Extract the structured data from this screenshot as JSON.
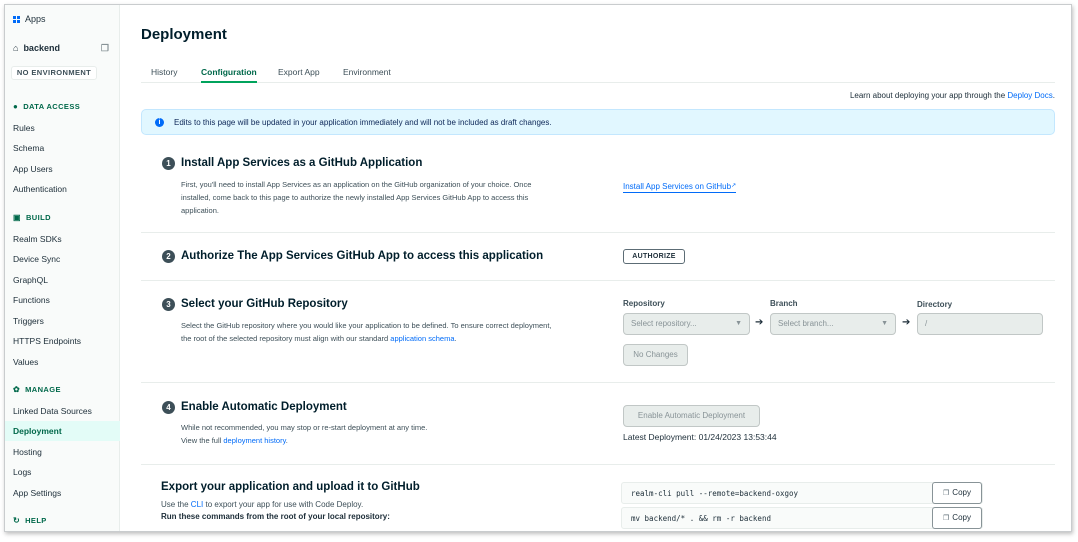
{
  "sidebar": {
    "apps_label": "Apps",
    "app_name": "backend",
    "environment": "NO ENVIRONMENT",
    "sections": [
      {
        "label": "DATA ACCESS",
        "icon": "database-icon"
      },
      {
        "label": "BUILD",
        "icon": "code-icon"
      },
      {
        "label": "MANAGE",
        "icon": "gear-icon"
      },
      {
        "label": "HELP",
        "icon": "help-icon"
      }
    ],
    "items": [
      "Rules",
      "Schema",
      "App Users",
      "Authentication",
      "Realm SDKs",
      "Device Sync",
      "GraphQL",
      "Functions",
      "Triggers",
      "HTTPS Endpoints",
      "Values",
      "Linked Data Sources",
      "Deployment",
      "Hosting",
      "Logs",
      "App Settings"
    ]
  },
  "page": {
    "title": "Deployment",
    "tabs": [
      "History",
      "Configuration",
      "Export App",
      "Environment"
    ],
    "learn_text": "Learn about deploying your app through the ",
    "learn_link": "Deploy Docs",
    "learn_end": "."
  },
  "banner": {
    "message": "Edits to this page will be updated in your application immediately and will not be included as draft changes."
  },
  "steps": {
    "s1": {
      "number": "1",
      "title": "Install App Services as a GitHub Application",
      "desc": "First, you'll need to install App Services as an application on the GitHub organization of your choice. Once installed, come back to this page to authorize the newly installed App Services GitHub App to access this application.",
      "link": "Install App Services on GitHub"
    },
    "s2": {
      "number": "2",
      "title": "Authorize The App Services GitHub App to access this application",
      "button": "AUTHORIZE"
    },
    "s3": {
      "number": "3",
      "title": "Select your GitHub Repository",
      "desc": "Select the GitHub repository where you would like your application to be defined. To ensure correct deployment, the root of the selected repository must align with our standard ",
      "desc_link": "application schema",
      "desc_end": ".",
      "repo_label": "Repository",
      "repo_placeholder": "Select repository...",
      "branch_label": "Branch",
      "branch_placeholder": "Select branch...",
      "dir_label": "Directory",
      "dir_value": "/",
      "no_changes": "No Changes"
    },
    "s4": {
      "number": "4",
      "title": "Enable Automatic Deployment",
      "desc1": "While not recommended, you may stop or re-start deployment at any time.",
      "desc2": "View the full ",
      "desc_link": "deployment history",
      "desc_end": ".",
      "button": "Enable Automatic Deployment",
      "latest": "Latest Deployment: 01/24/2023 13:53:44"
    }
  },
  "export": {
    "title": "Export your application and upload it to GitHub",
    "desc_pre": "Use the ",
    "desc_link": "CLI",
    "desc_post": " to export your app for use with Code Deploy.",
    "desc_bold": "Run these commands from the root of your local repository:",
    "commands": [
      "realm-cli pull --remote=backend-oxgoy",
      "mv backend/* . && rm -r backend"
    ],
    "copy_label": "Copy"
  }
}
